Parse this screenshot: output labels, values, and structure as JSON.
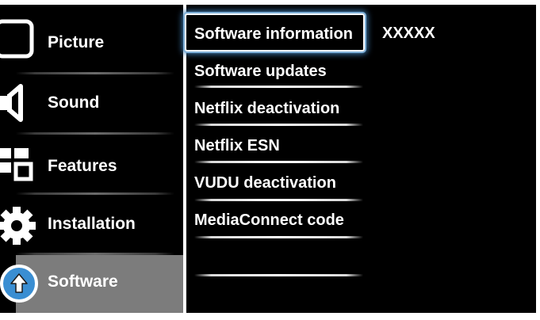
{
  "categories": [
    {
      "label": "Picture",
      "icon": "tv-screen-icon"
    },
    {
      "label": "Sound",
      "icon": "speaker-icon"
    },
    {
      "label": "Features",
      "icon": "features-grid-icon"
    },
    {
      "label": "Installation",
      "icon": "gear-icon"
    },
    {
      "label": "Software",
      "icon": "upload-arrow-icon",
      "selected": true
    }
  ],
  "submenu": [
    {
      "label": "Software information",
      "focused": true
    },
    {
      "label": "Software updates"
    },
    {
      "label": "Netflix deactivation"
    },
    {
      "label": "Netflix ESN"
    },
    {
      "label": "VUDU deactivation"
    },
    {
      "label": "MediaConnect code"
    }
  ],
  "value": {
    "software_information": "XXXXX"
  },
  "colors": {
    "background": "#000000",
    "selected_category": "#7c7c7c",
    "text": "#ffffff",
    "focus_glow": "#3e7fb8"
  }
}
